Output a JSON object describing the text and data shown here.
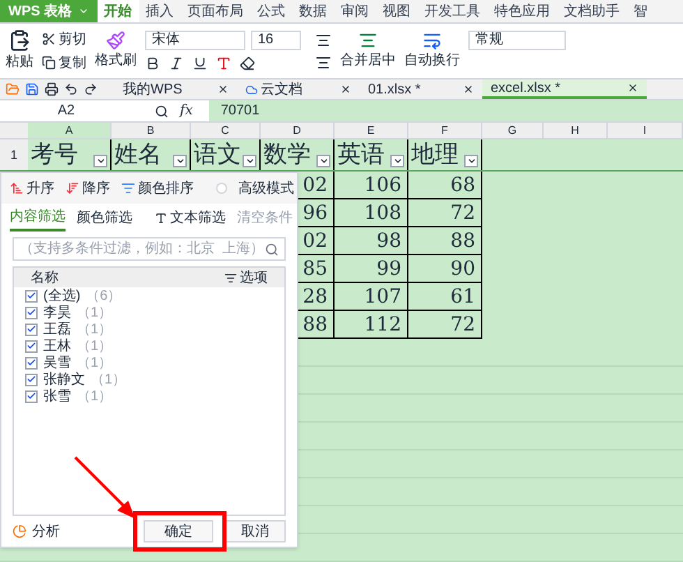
{
  "app_button": "WPS 表格",
  "top_tabs": [
    {
      "label": "开始",
      "selected": true
    },
    {
      "label": "插入",
      "selected": false
    },
    {
      "label": "页面布局",
      "selected": false
    },
    {
      "label": "公式",
      "selected": false
    },
    {
      "label": "数据",
      "selected": false
    },
    {
      "label": "审阅",
      "selected": false
    },
    {
      "label": "视图",
      "selected": false
    },
    {
      "label": "开发工具",
      "selected": false
    },
    {
      "label": "特色应用",
      "selected": false
    },
    {
      "label": "文档助手",
      "selected": false
    },
    {
      "label": "智",
      "selected": false
    }
  ],
  "ribbon": {
    "paste": "粘贴",
    "cut": "剪切",
    "copy": "复制",
    "format_painter": "格式刷",
    "font_name": "宋体",
    "font_size": "16",
    "merge": "合并居中",
    "wrap": "自动换行",
    "number_format": "常规"
  },
  "doc_tabs": [
    {
      "label": "我的WPS",
      "selected": false
    },
    {
      "label": "云文档",
      "selected": false
    },
    {
      "label": "01.xlsx *",
      "selected": false
    },
    {
      "label": "excel.xlsx *",
      "selected": true
    }
  ],
  "formula_bar": {
    "cell_ref": "A2",
    "fx": "fx",
    "value": "70701"
  },
  "sheet": {
    "columns": [
      "A",
      "B",
      "C",
      "D",
      "E",
      "F",
      "G",
      "H",
      "I"
    ],
    "header_row": {
      "row_number": "1",
      "cells": [
        "考号",
        "姓名",
        "语文",
        "数学",
        "英语",
        "地理"
      ]
    },
    "rows": [
      [
        "02",
        "106",
        "68"
      ],
      [
        "96",
        "108",
        "72"
      ],
      [
        "02",
        "98",
        "88"
      ],
      [
        "85",
        "99",
        "90"
      ],
      [
        "28",
        "107",
        "61"
      ],
      [
        "88",
        "112",
        "72"
      ]
    ]
  },
  "filter_panel": {
    "sort": [
      "升序",
      "降序",
      "颜色排序"
    ],
    "advanced": {
      "label": "高级模式",
      "on": false
    },
    "tabs": [
      {
        "label": "内容筛选",
        "selected": true
      },
      {
        "label": "颜色筛选",
        "selected": false
      }
    ],
    "text_filter": "文本筛选",
    "clear": {
      "label": "清空条件",
      "disabled": true
    },
    "search_placeholder": "（支持多条件过滤，例如：北京  上海）",
    "list_header": {
      "name": "名称",
      "options": "选项"
    },
    "items": [
      {
        "label": "(全选)",
        "count": "（6）",
        "checked": true
      },
      {
        "label": "李昊",
        "count": "（1）",
        "checked": true
      },
      {
        "label": "王磊",
        "count": "（1）",
        "checked": true
      },
      {
        "label": "王林",
        "count": "（1）",
        "checked": true
      },
      {
        "label": "吴雪",
        "count": "（1）",
        "checked": true
      },
      {
        "label": "张静文",
        "count": "（1）",
        "checked": true
      },
      {
        "label": "张雪",
        "count": "（1）",
        "checked": true
      }
    ],
    "analyze": "分析",
    "buttons": [
      "确定",
      "取消"
    ]
  }
}
